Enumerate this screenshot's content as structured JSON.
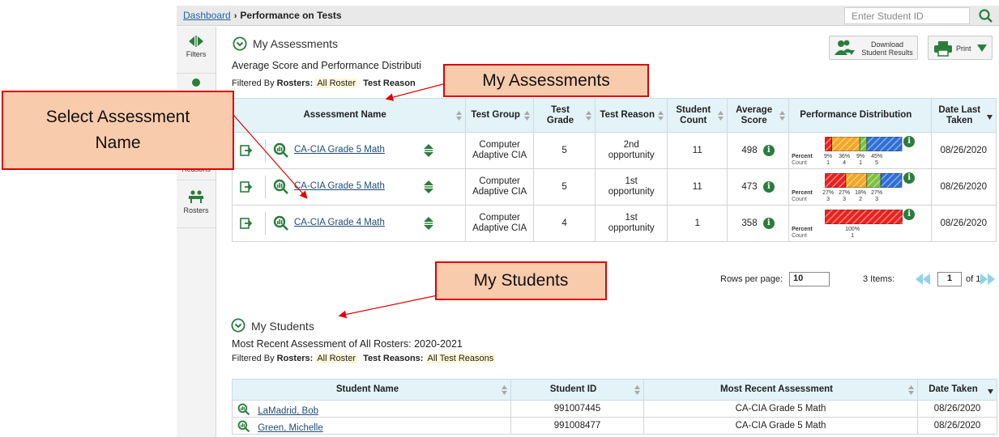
{
  "breadcrumb": {
    "link": "Dashboard",
    "current": "Performance on Tests"
  },
  "student_search": {
    "placeholder": "Enter Student ID"
  },
  "rail": [
    {
      "label": "Filters",
      "icon": "filters-icon"
    },
    {
      "label": "Reasons",
      "icon": "test-reasons-icon"
    },
    {
      "label": "Rosters",
      "icon": "rosters-icon"
    }
  ],
  "my_assessments": {
    "title": "My Assessments",
    "subtitle": "Average Score and Performance Distributi",
    "filter_label": "Filtered By",
    "rosters_label": "Rosters:",
    "rosters_value": "All Roster",
    "reasons_label": "Test Reason",
    "download_label_1": "Download",
    "download_label_2": "Student Results",
    "print_label": "Print",
    "columns": [
      "Assessment Name",
      "Test Group",
      "Test Grade",
      "Test Reason",
      "Student Count",
      "Average Score",
      "Performance Distribution",
      "Date Last Taken"
    ],
    "rows": [
      {
        "name": "CA-CIA Grade 5 Math",
        "group": "Computer Adaptive CIA",
        "grade": "5",
        "reason": "2nd opportunity",
        "count": "11",
        "score": "498",
        "date": "08/26/2020",
        "percents": [
          "9%",
          "36%",
          "9%",
          "45%"
        ],
        "counts": [
          "1",
          "4",
          "1",
          "5"
        ],
        "dist": [
          9,
          36,
          9,
          45
        ]
      },
      {
        "name": "CA-CIA Grade 5 Math",
        "group": "Computer Adaptive CIA",
        "grade": "5",
        "reason": "1st opportunity",
        "count": "11",
        "score": "473",
        "date": "08/26/2020",
        "percents": [
          "27%",
          "27%",
          "18%",
          "27%"
        ],
        "counts": [
          "3",
          "3",
          "2",
          "3"
        ],
        "dist": [
          27,
          27,
          18,
          27
        ]
      },
      {
        "name": "CA-CIA Grade 4 Math",
        "group": "Computer Adaptive CIA",
        "grade": "4",
        "reason": "1st opportunity",
        "count": "1",
        "score": "358",
        "date": "08/26/2020",
        "percents": [
          "100%"
        ],
        "counts": [
          "1"
        ],
        "dist": [
          100,
          0,
          0,
          0
        ]
      }
    ],
    "percent_label": "Percent",
    "count_label": "Count",
    "rows_per_page_label": "Rows per page:",
    "rows_per_page": "10",
    "items_label": "3 Items:",
    "page": "1",
    "of_label": "of 1"
  },
  "my_students": {
    "title": "My Students",
    "subtitle": "Most Recent Assessment of All Rosters: 2020-2021",
    "filter_label": "Filtered By",
    "rosters_label": "Rosters:",
    "rosters_value": "All Roster",
    "reasons_label": "Test Reasons:",
    "reasons_value": "All Test Reasons",
    "columns": [
      "Student Name",
      "Student ID",
      "Most Recent Assessment",
      "Date Taken"
    ],
    "rows": [
      {
        "name": "LaMadrid, Bob",
        "id": "991007445",
        "assessment": "CA-CIA Grade 5 Math",
        "date": "08/26/2020"
      },
      {
        "name": "Green, Michelle",
        "id": "991008477",
        "assessment": "CA-CIA Grade 5 Math",
        "date": "08/26/2020"
      }
    ]
  },
  "callouts": {
    "select": "Select Assessment Name",
    "assessments": "My Assessments",
    "students": "My Students"
  },
  "colors": {
    "red": "#e8231f",
    "orange": "#f5a623",
    "green": "#7cc242",
    "blue": "#2f6fd6",
    "accent_green": "#2a7d3c",
    "header_bg": "#e3f3f8",
    "callout_fill": "#f8cbad",
    "callout_border": "#e00000"
  }
}
